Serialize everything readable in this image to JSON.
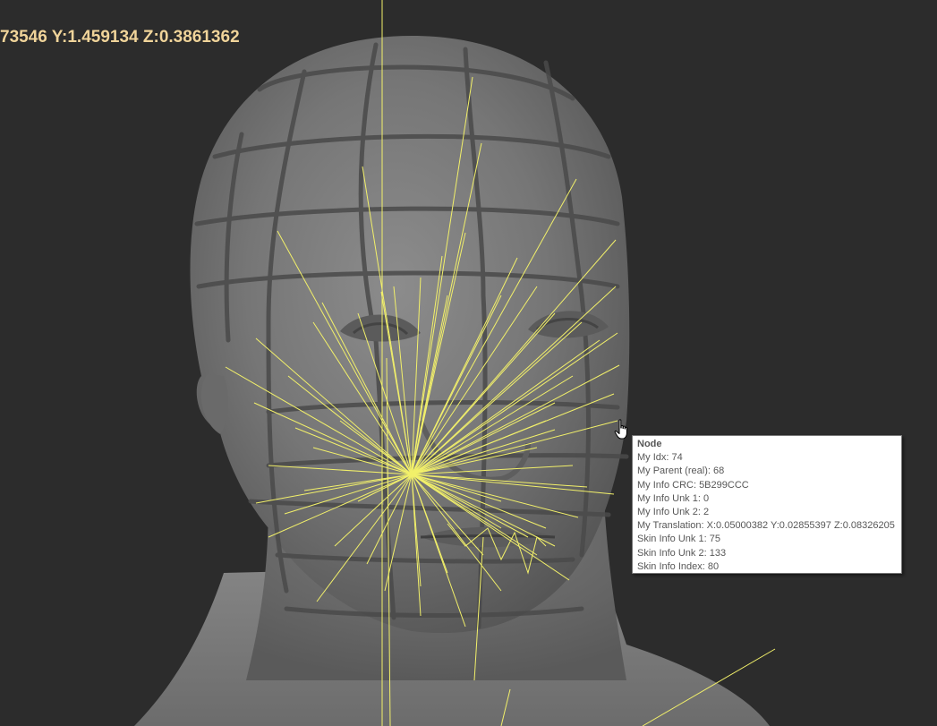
{
  "viewport": {
    "coordinate_readout": "73546 Y:1.459134 Z:0.3861362",
    "background_color": "#2c2c2c",
    "line_color": "#f2f06a",
    "readout_color": "#f0d49a"
  },
  "tooltip": {
    "title": "Node",
    "lines": [
      "My Idx: 74",
      "My Parent (real): 68",
      "My Info CRC: 5B299CCC",
      "My Info Unk 1: 0",
      "My Info Unk 2: 2",
      "My Translation: X:0.05000382 Y:0.02855397 Z:0.08326205",
      "Skin Info Unk 1: 75",
      "Skin Info Unk 2: 133",
      "Skin Info Index: 80"
    ]
  },
  "cursor": {
    "icon": "hand-pointer-icon"
  }
}
